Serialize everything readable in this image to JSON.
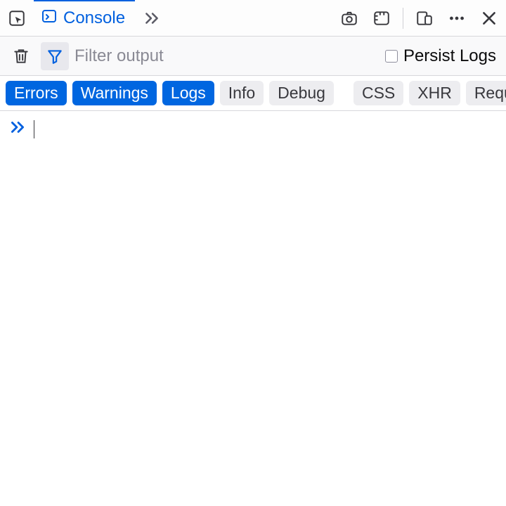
{
  "tabs": {
    "console_label": "Console"
  },
  "toolbar": {
    "filter_placeholder": "Filter output",
    "persist_label": "Persist Logs",
    "persist_checked": false
  },
  "categories": {
    "errors": {
      "label": "Errors",
      "on": true
    },
    "warnings": {
      "label": "Warnings",
      "on": true
    },
    "logs": {
      "label": "Logs",
      "on": true
    },
    "info": {
      "label": "Info",
      "on": false
    },
    "debug": {
      "label": "Debug",
      "on": false
    },
    "css": {
      "label": "CSS",
      "on": false
    },
    "xhr": {
      "label": "XHR",
      "on": false
    },
    "requests": {
      "label": "Requests",
      "on": false
    }
  },
  "console": {
    "input_value": ""
  },
  "icons": {
    "inspector": "inspector-icon",
    "console": "console-icon",
    "overflow": "chevrons-right-icon",
    "photo": "camera-icon",
    "ruler": "ruler-icon",
    "responsive": "devices-icon",
    "meatballs": "more-icon",
    "close": "close-icon",
    "trash": "trash-icon",
    "funnel": "funnel-icon",
    "prompt": "prompt-chevrons-icon"
  }
}
